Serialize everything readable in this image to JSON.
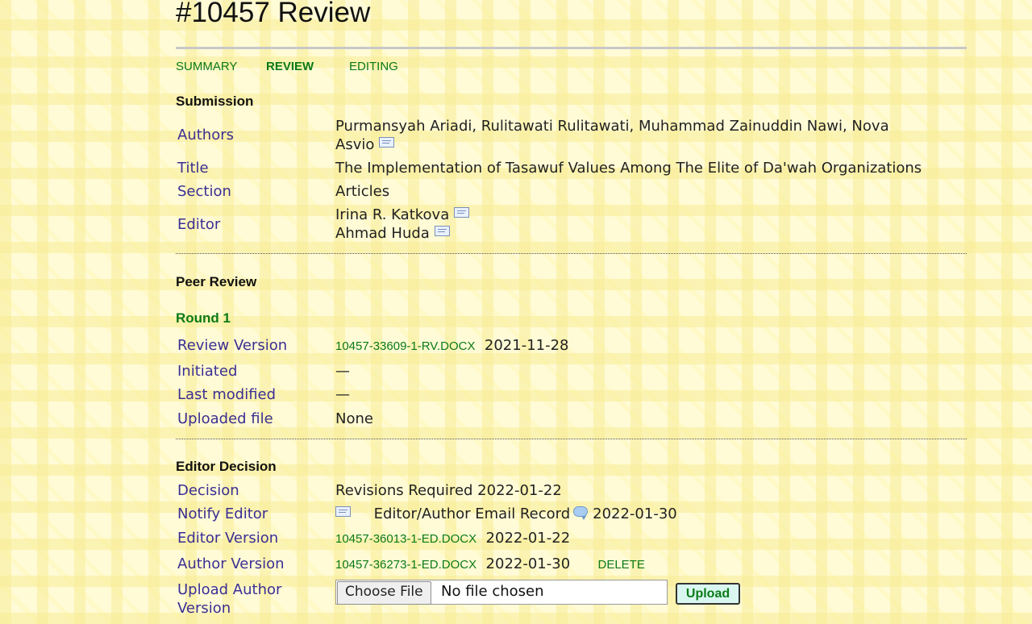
{
  "page_title": "#10457 Review",
  "tabs": [
    {
      "label": "SUMMARY",
      "active": false
    },
    {
      "label": "REVIEW",
      "active": true
    },
    {
      "label": "EDITING",
      "active": false
    }
  ],
  "submission": {
    "heading": "Submission",
    "authors_label": "Authors",
    "authors_line1": "Purmansyah Ariadi, Rulitawati Rulitawati, Muhammad Zainuddin Nawi, Nova",
    "authors_line2": "Asvio",
    "title_label": "Title",
    "title_value": "The Implementation of Tasawuf Values Among The Elite of Da'wah Organizations",
    "section_label": "Section",
    "section_value": "Articles",
    "editor_label": "Editor",
    "editors": [
      "Irina R. Katkova",
      "Ahmad Huda"
    ]
  },
  "peer_review": {
    "heading": "Peer Review",
    "round": "Round 1",
    "review_version_label": "Review Version",
    "review_version_file": "10457-33609-1-RV.DOCX",
    "review_version_date": "2021-11-28",
    "initiated_label": "Initiated",
    "initiated_value": "—",
    "last_modified_label": "Last modified",
    "last_modified_value": "—",
    "uploaded_file_label": "Uploaded file",
    "uploaded_file_value": "None"
  },
  "editor_decision": {
    "heading": "Editor Decision",
    "decision_label": "Decision",
    "decision_value": "Revisions Required 2022-01-22",
    "notify_label": "Notify Editor",
    "notify_record": "Editor/Author Email Record",
    "notify_date": "2022-01-30",
    "editor_version_label": "Editor Version",
    "editor_version_file": "10457-36013-1-ED.DOCX",
    "editor_version_date": "2022-01-22",
    "author_version_label": "Author Version",
    "author_version_file": "10457-36273-1-ED.DOCX",
    "author_version_date": "2022-01-30",
    "delete_label": "DELETE",
    "upload_label_line1": "Upload Author",
    "upload_label_line2": "Version",
    "choose_file_label": "Choose File",
    "no_file_text": "No file chosen",
    "upload_button": "Upload"
  },
  "icons": {
    "email": "envelope-icon",
    "comment": "speech-bubble-icon"
  },
  "colors": {
    "link_green": "#0a7a17",
    "label_purple": "#3b2f93",
    "background": "#fffbd6"
  }
}
